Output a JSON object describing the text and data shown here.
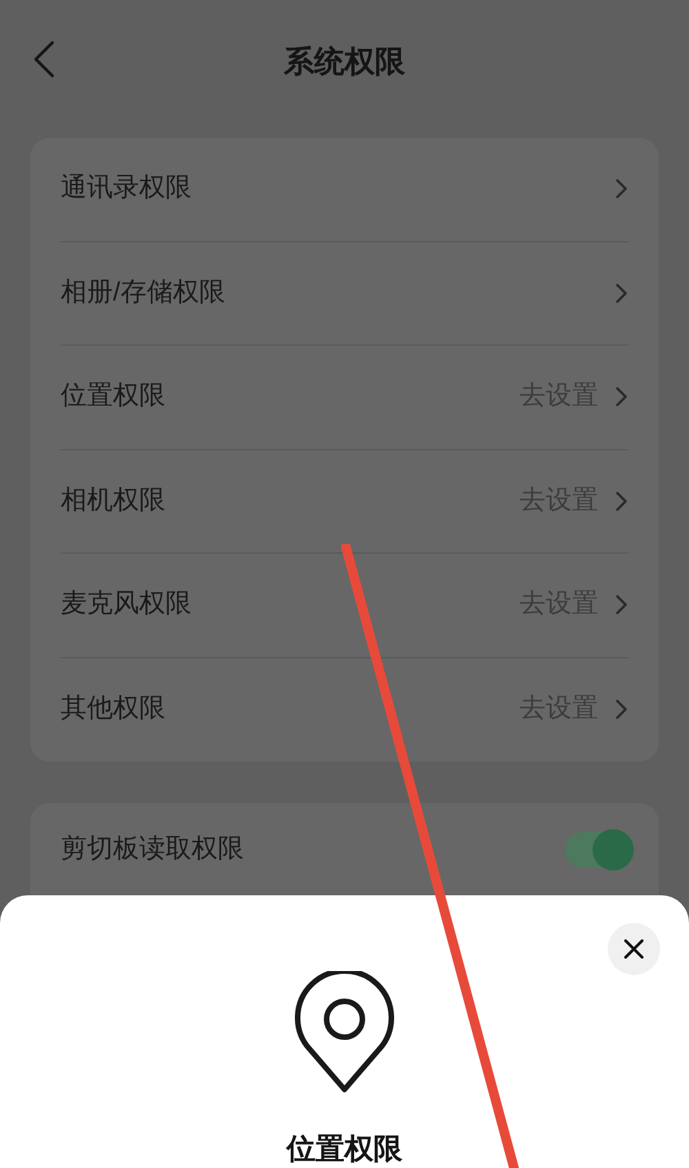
{
  "header": {
    "title": "系统权限"
  },
  "permissions": [
    {
      "label": "通讯录权限"
    },
    {
      "label": "相册/存储权限"
    },
    {
      "label": "位置权限",
      "action": "去设置"
    },
    {
      "label": "相机权限",
      "action": "去设置"
    },
    {
      "label": "麦克风权限",
      "action": "去设置"
    },
    {
      "label": "其他权限",
      "action": "去设置"
    }
  ],
  "clipboard": {
    "label": "剪切板读取权限",
    "on": true
  },
  "sheet": {
    "title": "位置权限"
  }
}
